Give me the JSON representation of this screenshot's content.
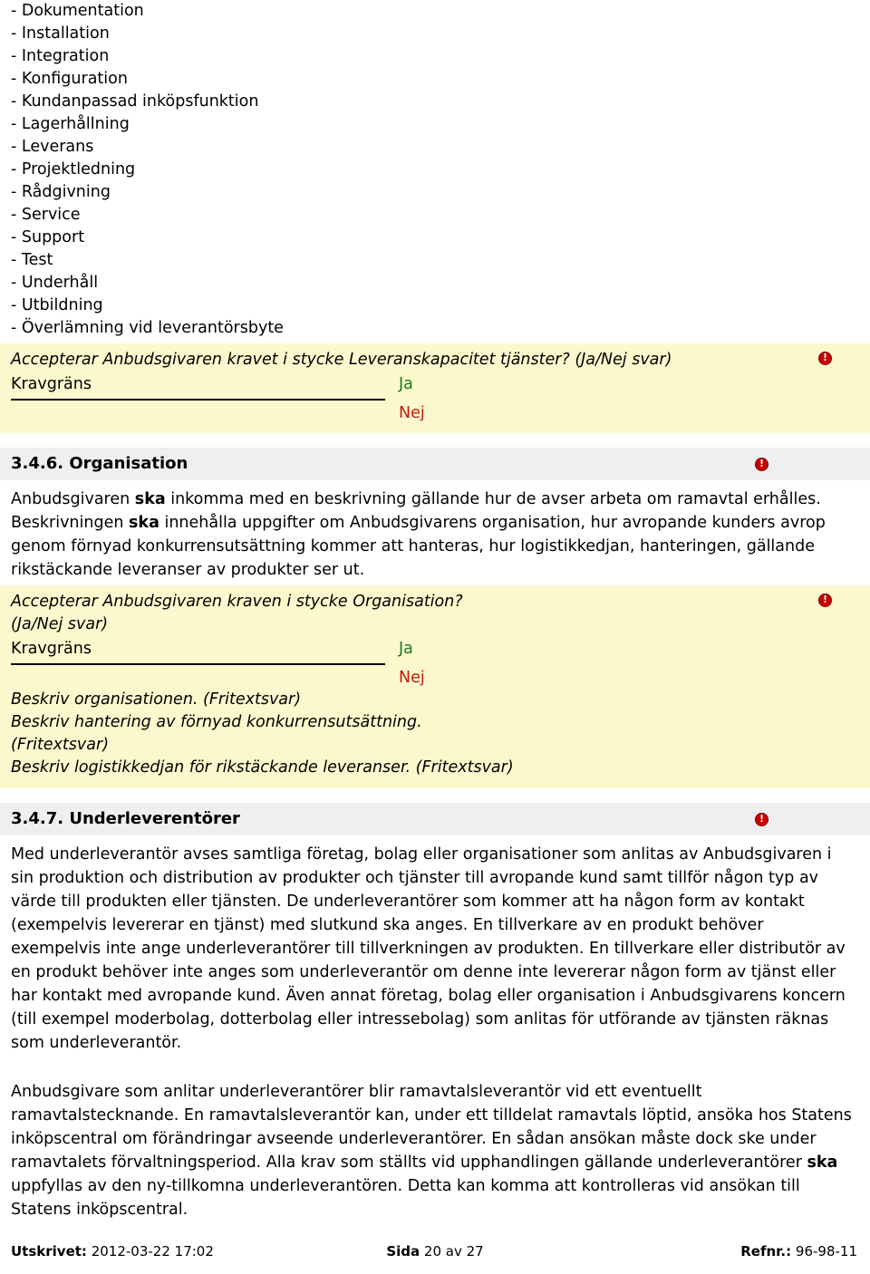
{
  "service_list": {
    "items": [
      "- Dokumentation",
      "- Installation",
      "- Integration",
      "- Konfiguration",
      "- Kundanpassad inköpsfunktion",
      "- Lagerhållning",
      "- Leverans",
      "- Projektledning",
      "- Rådgivning",
      "- Service",
      "- Support",
      "- Test",
      "- Underhåll",
      "- Utbildning",
      "- Överlämning vid leverantörsbyte"
    ]
  },
  "requirement_block_1": {
    "question": "Accepterar Anbudsgivaren kravet i stycke Leveranskapacitet tjänster? (Ja/Nej svar)",
    "kravgrans_label": "Kravgräns",
    "answer_yes": "Ja",
    "answer_no": "Nej",
    "warning_icon": "warning-exclamation-icon"
  },
  "section_346": {
    "heading": "3.4.6. Organisation",
    "warning_icon": "warning-exclamation-icon",
    "paragraph_parts": {
      "p1_a": "Anbudsgivaren ",
      "p1_b": "ska",
      "p1_c": " inkomma med en beskrivning gällande hur de avser arbeta om ramavtal erhålles. Beskrivningen ",
      "p1_d": "ska",
      "p1_e": " innehålla uppgifter om Anbudsgivarens organisation, hur avropande kunders avrop genom förnyad konkurrensutsättning kommer att hanteras, hur logistikkedjan, hanteringen, gällande rikstäckande leveranser av produkter ser ut."
    },
    "requirement_block": {
      "question_line1": "Accepterar Anbudsgivaren kraven i stycke Organisation?",
      "question_line2": "(Ja/Nej svar)",
      "kravgrans_label": "Kravgräns",
      "answer_yes": "Ja",
      "answer_no": "Nej",
      "freetext_1": "Beskriv organisationen. (Fritextsvar)",
      "freetext_2": "Beskriv hantering av förnyad konkurrensutsättning.",
      "freetext_3": "(Fritextsvar)",
      "freetext_4": "Beskriv logistikkedjan för rikstäckande leveranser. (Fritextsvar)",
      "warning_icon": "warning-exclamation-icon"
    }
  },
  "section_347": {
    "heading": "3.4.7. Underleverentörer",
    "warning_icon": "warning-exclamation-icon",
    "paragraph_1": "Med underleverantör avses samtliga företag, bolag eller organisationer som anlitas av Anbudsgivaren i sin produktion och distribution av produkter och tjänster till avropande kund samt tillför någon typ av värde till produkten eller tjänsten. De underleverantörer som kommer att ha någon form av kontakt (exempelvis levererar en tjänst) med slutkund ska anges. En tillverkare av en produkt behöver exempelvis inte ange underleverantörer till tillverkningen av produkten. En tillverkare eller distributör av en produkt behöver inte anges som underleverantör om denne inte levererar någon form av tjänst eller har kontakt med avropande kund. Även annat företag, bolag eller organisation i Anbudsgivarens koncern (till exempel moderbolag, dotterbolag eller intressebolag) som anlitas för utförande av tjänsten räknas som underleverantör.",
    "paragraph_2_parts": {
      "p2_a": "Anbudsgivare som anlitar underleverantörer blir ramavtalsleverantör vid ett eventuellt ramavtalstecknande. En ramavtalsleverantör kan, under ett tilldelat ramavtals löptid, ansöka hos Statens inköpscentral om förändringar avseende underleverantörer. En sådan ansökan måste dock ske under ramavtalets förvaltningsperiod. Alla krav som ställts vid upphandlingen gällande underleverantörer ",
      "p2_b": "ska",
      "p2_c": " uppfyllas av den ny-tillkomna underleverantören. Detta kan komma att kontrolleras vid ansökan till Statens inköpscentral."
    }
  },
  "footer": {
    "printed_label": "Utskrivet:",
    "printed_value": "2012-03-22 17:02",
    "page_label": "Sida",
    "page_value": "20 av 27",
    "ref_label": "Refnr.:",
    "ref_value": "96-98-11"
  },
  "colors": {
    "highlight_yellow": "#fbf8cd",
    "heading_gray": "#efefef",
    "answer_yes": "#1a7a1a",
    "answer_no": "#c21a0f",
    "warning_red": "#cc0000"
  }
}
